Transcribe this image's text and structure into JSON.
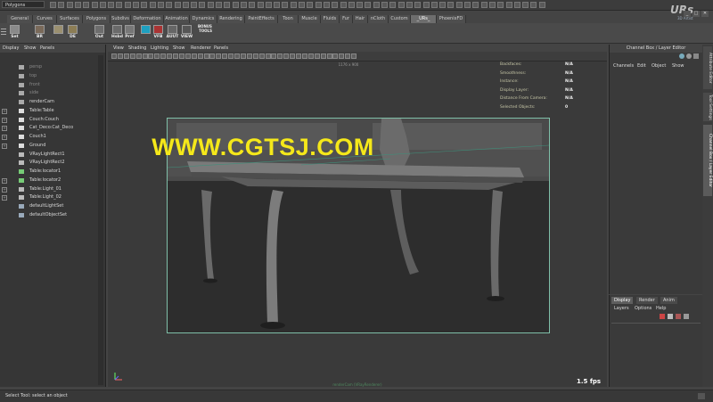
{
  "status_line": {
    "mode": "Polygons"
  },
  "logo": {
    "text": "URs",
    "sub": "3D Artist"
  },
  "window_controls": [
    "_",
    "□",
    "✕"
  ],
  "shelf_tabs": [
    {
      "label": "General",
      "active": false
    },
    {
      "label": "Curves",
      "active": false
    },
    {
      "label": "Surfaces",
      "active": false
    },
    {
      "label": "Polygons",
      "active": false
    },
    {
      "label": "Subdivs",
      "active": false
    },
    {
      "label": "Deformation",
      "active": false
    },
    {
      "label": "Animation",
      "active": false
    },
    {
      "label": "Dynamics",
      "active": false
    },
    {
      "label": "Rendering",
      "active": false
    },
    {
      "label": "PaintEffects",
      "active": false
    },
    {
      "label": "Toon",
      "active": false
    },
    {
      "label": "Muscle",
      "active": false
    },
    {
      "label": "Fluids",
      "active": false
    },
    {
      "label": "Fur",
      "active": false
    },
    {
      "label": "Hair",
      "active": false
    },
    {
      "label": "nCloth",
      "active": false
    },
    {
      "label": "Custom",
      "active": false
    },
    {
      "label": "_URs_",
      "active": true
    },
    {
      "label": "PhoenixFD",
      "active": false
    }
  ],
  "shelf_buttons": [
    {
      "label": "Set",
      "icon": "set-icon"
    },
    {
      "label": "BR",
      "icon": "br-icon"
    },
    {
      "label": "",
      "icon": "shader-icon"
    },
    {
      "label": "DE",
      "icon": "de-icon"
    },
    {
      "label": "Out",
      "icon": "out-icon"
    },
    {
      "label": "Hsbd",
      "icon": "hsbd-icon"
    },
    {
      "label": "Pref",
      "icon": "pref-icon"
    },
    {
      "label": "",
      "icon": "active-tool-icon"
    },
    {
      "label": "VFB",
      "icon": "vfb-icon"
    },
    {
      "label": "AUUT",
      "icon": "auut-icon"
    },
    {
      "label": "VIEW",
      "icon": "view-icon"
    }
  ],
  "shelf_top_texts": {
    "bonus": "BONUS",
    "tools": "TOOLS"
  },
  "outliner": {
    "menu": [
      "Display",
      "Show",
      "Panels"
    ],
    "items": [
      {
        "label": "persp",
        "dim": true,
        "expandable": false,
        "icon": "camera-icon"
      },
      {
        "label": "top",
        "dim": true,
        "expandable": false,
        "icon": "camera-icon"
      },
      {
        "label": "front",
        "dim": true,
        "expandable": false,
        "icon": "camera-icon"
      },
      {
        "label": "side",
        "dim": true,
        "expandable": false,
        "icon": "camera-icon"
      },
      {
        "label": "renderCam",
        "dim": false,
        "expandable": false,
        "icon": "camera-icon"
      },
      {
        "label": "Table:Table",
        "dim": false,
        "expandable": true,
        "icon": "mesh-icon"
      },
      {
        "label": "Couch:Couch",
        "dim": false,
        "expandable": true,
        "icon": "mesh-icon"
      },
      {
        "label": "Cat_Deco:Cat_Deco",
        "dim": false,
        "expandable": true,
        "icon": "mesh-icon"
      },
      {
        "label": "Couch1",
        "dim": false,
        "expandable": true,
        "icon": "mesh-icon"
      },
      {
        "label": "Ground",
        "dim": false,
        "expandable": true,
        "icon": "mesh-icon"
      },
      {
        "label": "VRayLightRect1",
        "dim": false,
        "expandable": false,
        "icon": "light-icon"
      },
      {
        "label": "VRayLightRect2",
        "dim": false,
        "expandable": false,
        "icon": "light-icon"
      },
      {
        "label": "Table:locator1",
        "dim": false,
        "expandable": false,
        "icon": "locator-icon"
      },
      {
        "label": "Table:locator2",
        "dim": false,
        "expandable": true,
        "icon": "locator-icon"
      },
      {
        "label": "Table:Light_01",
        "dim": false,
        "expandable": true,
        "icon": "light-icon"
      },
      {
        "label": "Table:Light_02",
        "dim": false,
        "expandable": true,
        "icon": "light-icon"
      },
      {
        "label": "defaultLightSet",
        "dim": false,
        "expandable": false,
        "icon": "set-icon"
      },
      {
        "label": "defaultObjectSet",
        "dim": false,
        "expandable": false,
        "icon": "set-icon"
      }
    ]
  },
  "viewport": {
    "menu": [
      "View",
      "Shading",
      "Lighting",
      "Show",
      "Renderer",
      "Panels"
    ],
    "resolution": "1176 x 900",
    "hud": [
      {
        "label": "Backfaces:",
        "value": "N/A"
      },
      {
        "label": "Smoothness:",
        "value": "N/A"
      },
      {
        "label": "Instance:",
        "value": "N/A"
      },
      {
        "label": "Display Layer:",
        "value": "N/A"
      },
      {
        "label": "Distance From Camera:",
        "value": "N/A"
      },
      {
        "label": "Selected Objects:",
        "value": "0"
      }
    ],
    "watermark": "WWW.CGTSJ.COM",
    "fps": "1.5 fps",
    "camera_label": "renderCam (VRayRenderer)"
  },
  "channel_box": {
    "title": "Channel Box / Layer Editor",
    "menu": [
      "Channels",
      "Edit",
      "Object",
      "Show"
    ]
  },
  "layer_editor": {
    "tabs": [
      {
        "label": "Display",
        "active": true
      },
      {
        "label": "Render",
        "active": false
      },
      {
        "label": "Anim",
        "active": false
      }
    ],
    "menu": [
      "Layers",
      "Options",
      "Help"
    ]
  },
  "side_tabs": [
    {
      "label": "Attribute Editor",
      "active": false
    },
    {
      "label": "Tool Settings",
      "active": false
    },
    {
      "label": "Channel Box / Layer Editor",
      "active": true
    }
  ],
  "help_line": "Select Tool: select an object",
  "colors": {
    "watermark": "#f5e81a",
    "active_tab": "#6d6d6d",
    "viewport_border": "#7fbfa8"
  }
}
